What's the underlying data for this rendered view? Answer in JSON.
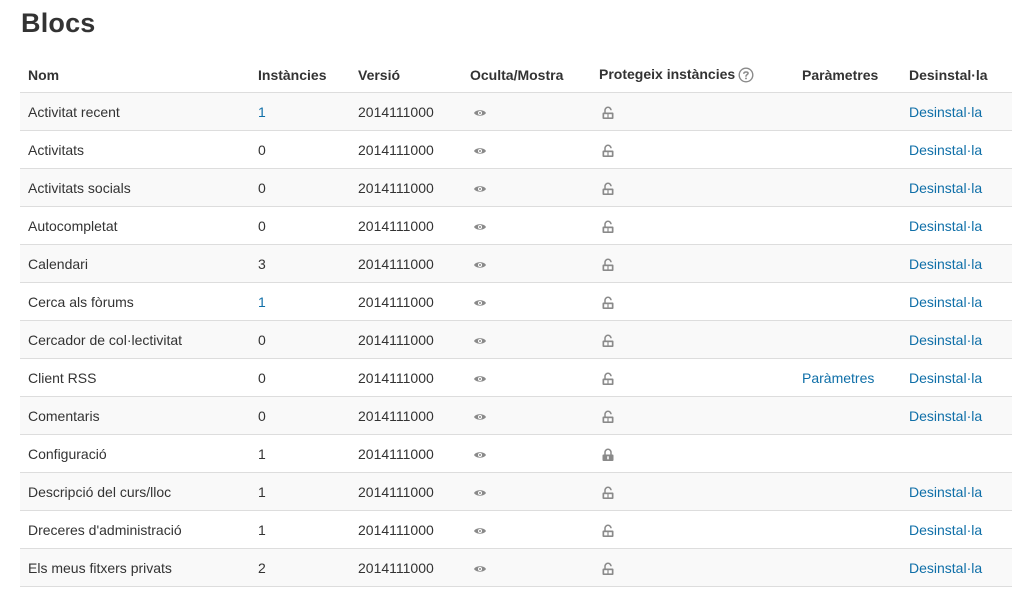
{
  "page": {
    "title": "Blocs"
  },
  "table": {
    "headers": {
      "name": "Nom",
      "instances": "Instàncies",
      "version": "Versió",
      "hide_show": "Oculta/Mostra",
      "protect": "Protegeix instàncies",
      "settings": "Paràmetres",
      "uninstall": "Desinstal·la"
    },
    "rows": [
      {
        "name": "Activitat recent",
        "instances": "1",
        "instances_link": true,
        "version": "2014111000",
        "locked": false,
        "settings": "",
        "uninstall": "Desinstal·la"
      },
      {
        "name": "Activitats",
        "instances": "0",
        "instances_link": false,
        "version": "2014111000",
        "locked": false,
        "settings": "",
        "uninstall": "Desinstal·la"
      },
      {
        "name": "Activitats socials",
        "instances": "0",
        "instances_link": false,
        "version": "2014111000",
        "locked": false,
        "settings": "",
        "uninstall": "Desinstal·la"
      },
      {
        "name": "Autocompletat",
        "instances": "0",
        "instances_link": false,
        "version": "2014111000",
        "locked": false,
        "settings": "",
        "uninstall": "Desinstal·la"
      },
      {
        "name": "Calendari",
        "instances": "3",
        "instances_link": false,
        "version": "2014111000",
        "locked": false,
        "settings": "",
        "uninstall": "Desinstal·la"
      },
      {
        "name": "Cerca als fòrums",
        "instances": "1",
        "instances_link": true,
        "version": "2014111000",
        "locked": false,
        "settings": "",
        "uninstall": "Desinstal·la"
      },
      {
        "name": "Cercador de col·lectivitat",
        "instances": "0",
        "instances_link": false,
        "version": "2014111000",
        "locked": false,
        "settings": "",
        "uninstall": "Desinstal·la"
      },
      {
        "name": "Client RSS",
        "instances": "0",
        "instances_link": false,
        "version": "2014111000",
        "locked": false,
        "settings": "Paràmetres",
        "uninstall": "Desinstal·la"
      },
      {
        "name": "Comentaris",
        "instances": "0",
        "instances_link": false,
        "version": "2014111000",
        "locked": false,
        "settings": "",
        "uninstall": "Desinstal·la"
      },
      {
        "name": "Configuració",
        "instances": "1",
        "instances_link": false,
        "version": "2014111000",
        "locked": true,
        "settings": "",
        "uninstall": ""
      },
      {
        "name": "Descripció del curs/lloc",
        "instances": "1",
        "instances_link": false,
        "version": "2014111000",
        "locked": false,
        "settings": "",
        "uninstall": "Desinstal·la"
      },
      {
        "name": "Dreceres d'administració",
        "instances": "1",
        "instances_link": false,
        "version": "2014111000",
        "locked": false,
        "settings": "",
        "uninstall": "Desinstal·la"
      },
      {
        "name": "Els meus fitxers privats",
        "instances": "2",
        "instances_link": false,
        "version": "2014111000",
        "locked": false,
        "settings": "",
        "uninstall": "Desinstal·la"
      }
    ]
  },
  "icons": {
    "hide_show": "eye-icon",
    "protect_unlocked": "unlock-icon",
    "protect_locked": "lock-icon",
    "help": "help-icon"
  },
  "colors": {
    "link": "#0f6fa8",
    "icon": "#8a8a8a",
    "row_stripe": "#f9f9f9",
    "border": "#dddddd"
  }
}
